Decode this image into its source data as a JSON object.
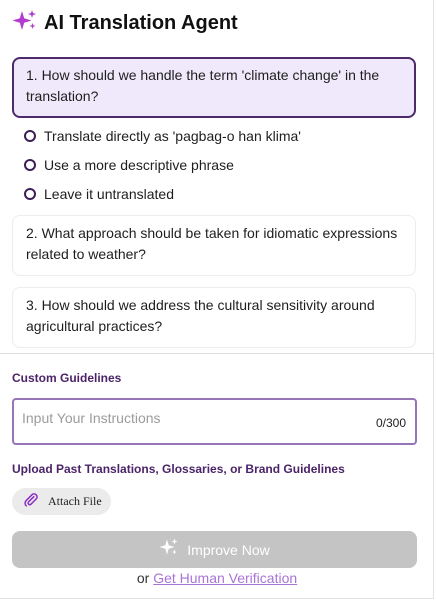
{
  "header": {
    "title": "AI Translation Agent",
    "icon": "sparkles-icon",
    "icon_color": "#b33bd0"
  },
  "questions": [
    {
      "text": "1. How should we handle the term 'climate change' in the translation?",
      "active": true
    },
    {
      "text": "2. What approach should be taken for idiomatic expressions related to weather?",
      "active": false
    },
    {
      "text": "3. How should we address the cultural sensitivity around agricultural practices?",
      "active": false
    }
  ],
  "options": [
    "Translate directly as 'pagbag-o han klima'",
    "Use a more descriptive phrase",
    "Leave it untranslated"
  ],
  "custom_guidelines": {
    "label": "Custom Guidelines",
    "placeholder": "Input Your Instructions",
    "value": "",
    "counter": "0/300"
  },
  "upload": {
    "label": "Upload Past Translations, Glossaries, or Brand Guidelines",
    "attach_label": "Attach File",
    "icon": "paperclip-icon"
  },
  "improve_button": {
    "label": "Improve Now",
    "icon": "sparkles-icon",
    "background": "#c4c4c4"
  },
  "footer": {
    "prefix": "or",
    "link_label": "Get Human Verification",
    "link_color": "#a874d6"
  },
  "colors": {
    "accent_dark": "#4c2a6c",
    "active_card_bg": "#f0e9fb",
    "section_label": "#4b2368"
  }
}
